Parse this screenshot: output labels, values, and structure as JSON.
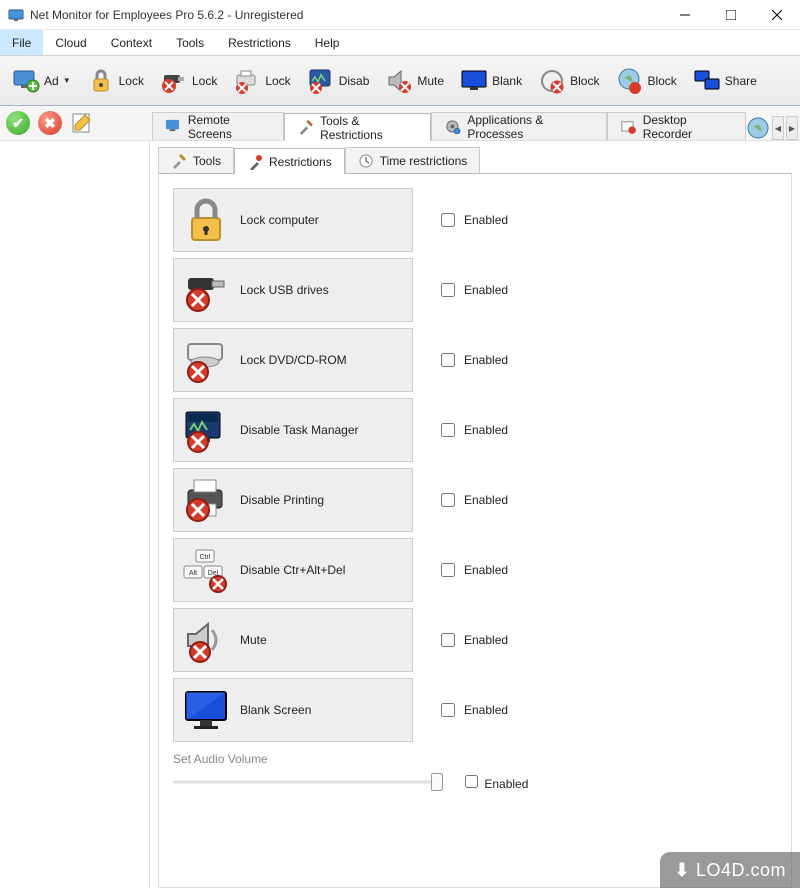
{
  "window": {
    "title": "Net Monitor for Employees Pro 5.6.2 - Unregistered"
  },
  "menubar": [
    "File",
    "Cloud",
    "Context",
    "Tools",
    "Restrictions",
    "Help"
  ],
  "toolbar": [
    {
      "icon": "add-monitor",
      "label": "Ad",
      "caret": true
    },
    {
      "icon": "lock",
      "label": "Lock"
    },
    {
      "icon": "lock-usb",
      "label": "Lock"
    },
    {
      "icon": "lock-printer",
      "label": "Lock"
    },
    {
      "icon": "disable-tm",
      "label": "Disab"
    },
    {
      "icon": "mute",
      "label": "Mute"
    },
    {
      "icon": "blank-screen",
      "label": "Blank"
    },
    {
      "icon": "block",
      "label": "Block"
    },
    {
      "icon": "block-globe",
      "label": "Block"
    },
    {
      "icon": "share",
      "label": "Share"
    }
  ],
  "main_tabs": [
    {
      "icon": "remote-screens",
      "label": "Remote Screens"
    },
    {
      "icon": "tools-restrictions",
      "label": "Tools & Restrictions",
      "active": true
    },
    {
      "icon": "apps-processes",
      "label": "Applications & Processes"
    },
    {
      "icon": "desktop-recorder",
      "label": "Desktop Recorder"
    }
  ],
  "sub_tabs": [
    {
      "icon": "tools",
      "label": "Tools"
    },
    {
      "icon": "restrictions",
      "label": "Restrictions",
      "active": true
    },
    {
      "icon": "time",
      "label": "Time restrictions"
    }
  ],
  "restrictions": [
    {
      "icon": "lock-computer",
      "label": "Lock computer",
      "enabled_label": "Enabled"
    },
    {
      "icon": "lock-usb",
      "label": "Lock USB drives",
      "enabled_label": "Enabled"
    },
    {
      "icon": "lock-dvd",
      "label": "Lock DVD/CD-ROM",
      "enabled_label": "Enabled"
    },
    {
      "icon": "taskmgr",
      "label": "Disable Task Manager",
      "enabled_label": "Enabled"
    },
    {
      "icon": "printer",
      "label": "Disable Printing",
      "enabled_label": "Enabled"
    },
    {
      "icon": "cad",
      "label": "Disable Ctr+Alt+Del",
      "enabled_label": "Enabled"
    },
    {
      "icon": "mute",
      "label": "Mute",
      "enabled_label": "Enabled"
    },
    {
      "icon": "blank",
      "label": "Blank Screen",
      "enabled_label": "Enabled"
    }
  ],
  "audio": {
    "label": "Set Audio Volume",
    "enabled_label": "Enabled"
  },
  "watermark": "LO4D.com"
}
